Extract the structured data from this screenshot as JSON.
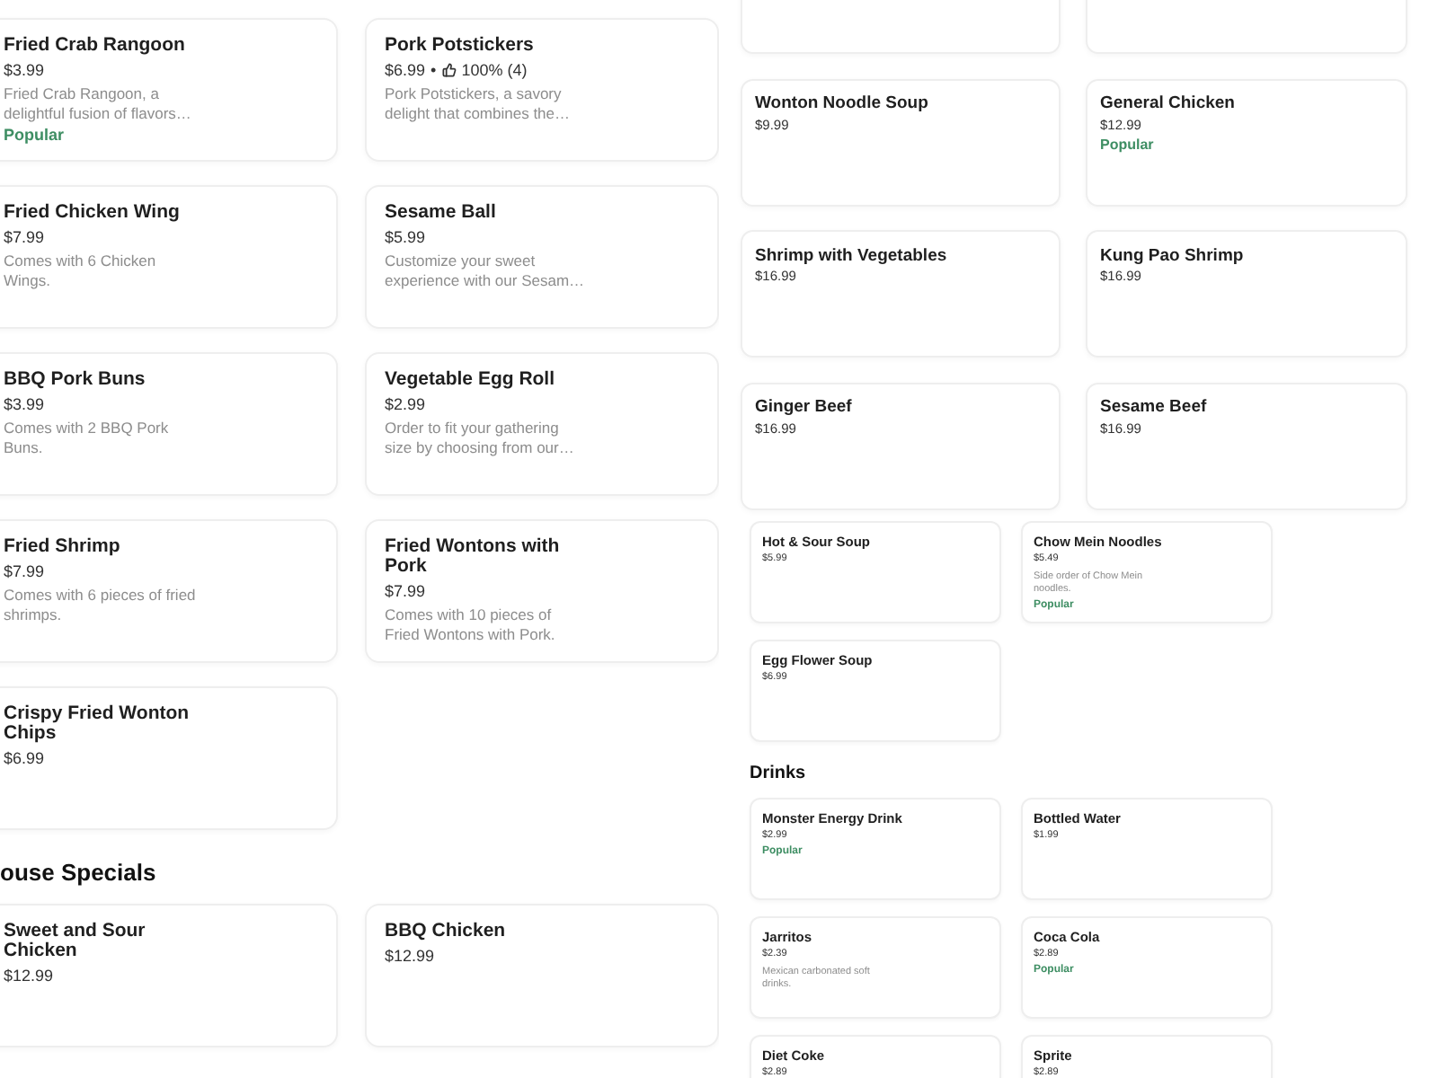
{
  "left_panel": {
    "sections": [
      {
        "items": [
          {
            "name": "Fried Crab Rangoon",
            "price": "$3.99",
            "description": "Fried Crab Rangoon, a delightful fusion of flavors…",
            "tag": "Popular"
          },
          {
            "name": "Pork Potstickers",
            "price": "$6.99",
            "separator": "•",
            "rating": "100% (4)",
            "description": "Pork Potstickers, a savory delight that combines the…"
          },
          {
            "name": "Fried Chicken Wing",
            "price": "$7.99",
            "description": "Comes with 6 Chicken Wings."
          },
          {
            "name": "Sesame Ball",
            "price": "$5.99",
            "description": "Customize your sweet experience with our Sesam…"
          },
          {
            "name": "BBQ Pork Buns",
            "price": "$3.99",
            "description": "Comes with 2 BBQ Pork Buns."
          },
          {
            "name": "Vegetable Egg Roll",
            "price": "$2.99",
            "description": "Order to fit your gathering size by choosing from our…"
          },
          {
            "name": "Fried Shrimp",
            "price": "$7.99",
            "description": "Comes with 6 pieces of fried shrimps."
          },
          {
            "name": "Fried Wontons with Pork",
            "price": "$7.99",
            "description": "Comes with 10 pieces of Fried Wontons with Pork."
          },
          {
            "name": "Crispy Fried Wonton Chips",
            "price": "$6.99"
          }
        ]
      },
      {
        "heading": "ouse Specials",
        "items": [
          {
            "name": "Sweet and Sour Chicken",
            "price": "$12.99"
          },
          {
            "name": "BBQ Chicken",
            "price": "$12.99"
          }
        ]
      }
    ]
  },
  "top_right_panel": {
    "items": [
      {
        "name": "Wonton Noodle Soup",
        "price": "$9.99"
      },
      {
        "name": "General Chicken",
        "price": "$12.99",
        "tag": "Popular"
      },
      {
        "name": "Shrimp with Vegetables",
        "price": "$16.99"
      },
      {
        "name": "Kung Pao Shrimp",
        "price": "$16.99"
      },
      {
        "name": "Ginger Beef",
        "price": "$16.99"
      },
      {
        "name": "Sesame Beef",
        "price": "$16.99"
      }
    ]
  },
  "bottom_right_panel": {
    "sections": [
      {
        "items": [
          {
            "name": "Hot & Sour Soup",
            "price": "$5.99"
          },
          {
            "name": "Chow Mein Noodles",
            "price": "$5.49",
            "description": "Side order of Chow Mein noodles.",
            "tag": "Popular"
          },
          {
            "name": "Egg Flower Soup",
            "price": "$6.99"
          }
        ]
      },
      {
        "heading": "Drinks",
        "items": [
          {
            "name": "Monster Energy Drink",
            "price": "$2.99",
            "tag": "Popular"
          },
          {
            "name": "Bottled Water",
            "price": "$1.99"
          },
          {
            "name": "Jarritos",
            "price": "$2.39",
            "description": "Mexican carbonated soft drinks."
          },
          {
            "name": "Coca Cola",
            "price": "$2.89",
            "tag": "Popular"
          },
          {
            "name": "Diet Coke",
            "price": "$2.89"
          },
          {
            "name": "Sprite",
            "price": "$2.89"
          }
        ]
      }
    ]
  }
}
